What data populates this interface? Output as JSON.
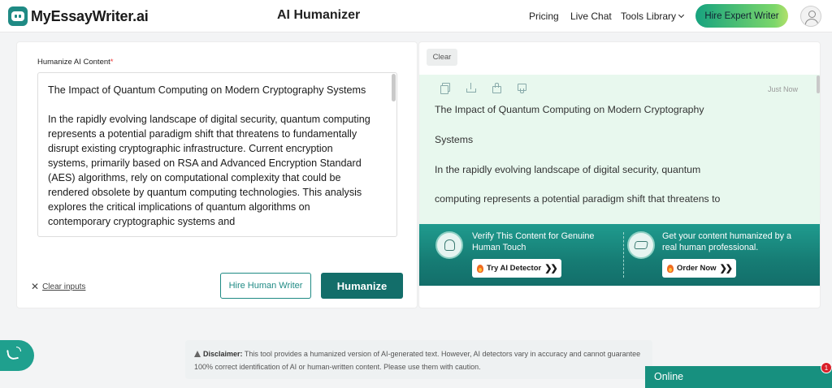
{
  "header": {
    "logo_text": "MyEssayWriter.ai",
    "page_title": "AI Humanizer",
    "nav": {
      "pricing": "Pricing",
      "live_chat": "Live Chat",
      "tools_library": "Tools Library"
    },
    "hire_button": "Hire Expert Writer"
  },
  "input": {
    "label": "Humanize AI Content",
    "required_mark": "*",
    "text": "The Impact of Quantum Computing on Modern Cryptography Systems\n\nIn the rapidly evolving landscape of digital security, quantum computing represents a potential paradigm shift that threatens to fundamentally disrupt existing cryptographic infrastructure. Current encryption systems, primarily based on RSA and Advanced Encryption Standard (AES) algorithms, rely on computational complexity that could be rendered obsolete by quantum computing technologies. This analysis explores the critical implications of quantum algorithms on contemporary cryptographic systems and"
  },
  "actions": {
    "clear_inputs": "Clear inputs",
    "hire_human_writer": "Hire Human Writer",
    "humanize": "Humanize"
  },
  "output": {
    "clear": "Clear",
    "timestamp": "Just Now",
    "lines": [
      "The Impact of Quantum Computing on Modern Cryptography",
      "Systems",
      "In the rapidly evolving landscape of digital security, quantum",
      "computing represents a potential paradigm shift that threatens to"
    ],
    "icons": [
      "copy-icon",
      "download-icon",
      "thumbs-up-icon",
      "thumbs-down-icon"
    ]
  },
  "promo": {
    "verify_text": "Verify This Content for Genuine Human Touch",
    "verify_button": "Try AI Detector",
    "human_text": "Get your content humanized by a real human professional.",
    "human_button": "Order Now"
  },
  "disclaimer": {
    "title": "Disclaimer:",
    "text": "This tool provides a humanized version of AI-generated text. However, AI detectors vary in accuracy and cannot guarantee 100% correct identification of AI or human-written content. Please use them with caution."
  },
  "chat": {
    "online": "Online",
    "badge": "1"
  },
  "colors": {
    "brand": "#1f8a84",
    "humanize": "#136e6a",
    "output_bg": "#e8f8ee"
  }
}
